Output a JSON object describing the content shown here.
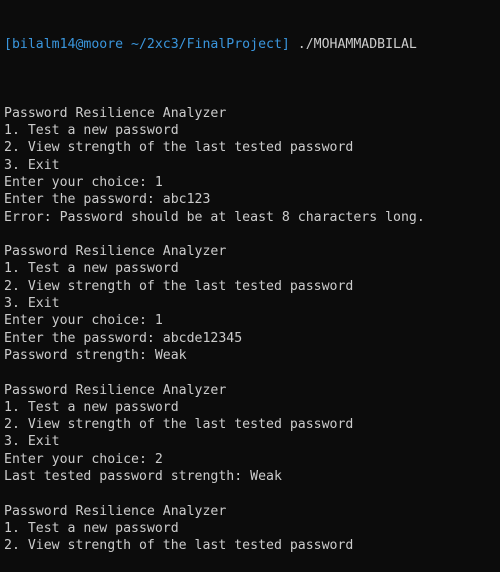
{
  "prompt": {
    "text": "[bilalm14@moore ~/2xc3/FinalProject]",
    "command": " ./MOHAMMADBILAL"
  },
  "output": [
    "",
    "Password Resilience Analyzer",
    "1. Test a new password",
    "2. View strength of the last tested password",
    "3. Exit",
    "Enter your choice: 1",
    "Enter the password: abc123",
    "Error: Password should be at least 8 characters long.",
    "",
    "Password Resilience Analyzer",
    "1. Test a new password",
    "2. View strength of the last tested password",
    "3. Exit",
    "Enter your choice: 1",
    "Enter the password: abcde12345",
    "Password strength: Weak",
    "",
    "Password Resilience Analyzer",
    "1. Test a new password",
    "2. View strength of the last tested password",
    "3. Exit",
    "Enter your choice: 2",
    "Last tested password strength: Weak",
    "",
    "Password Resilience Analyzer",
    "1. Test a new password",
    "2. View strength of the last tested password"
  ]
}
